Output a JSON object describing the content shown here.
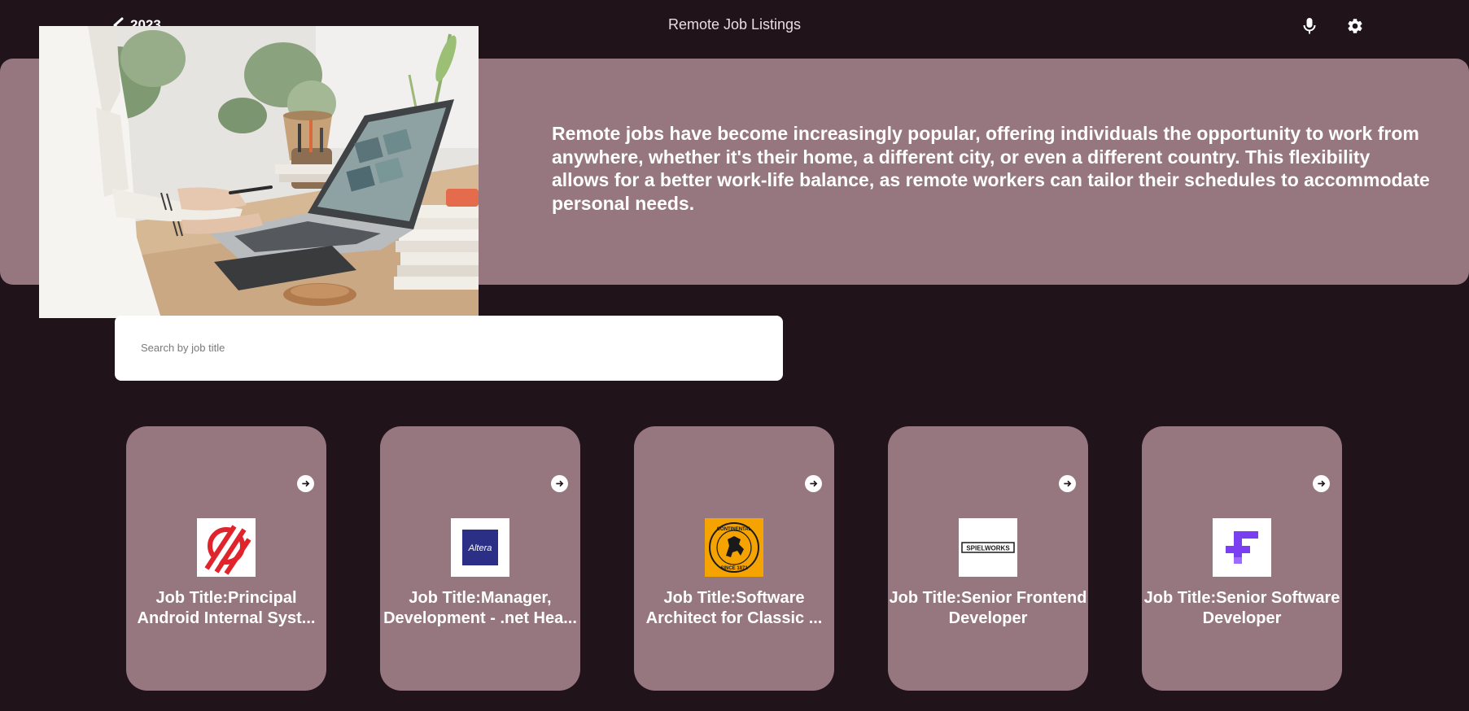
{
  "header": {
    "back_label": "2023",
    "title": "Remote Job Listings",
    "icons": [
      "back-arrow-icon",
      "microphone-icon",
      "gear-icon"
    ]
  },
  "hero": {
    "text": "Remote jobs have become increasingly popular, offering individuals the opportunity to work from anywhere, whether it's their home, a different city, or even a different country. This flexibility allows for a better work-life balance, as remote workers can tailor their schedules to accommodate personal needs.",
    "image": "person-typing-on-laptop-at-desk"
  },
  "search": {
    "placeholder": "Search by job title",
    "value": ""
  },
  "jobs": [
    {
      "title_line1": "Job Title:Principal",
      "title_line2": "Android Internal Syst...",
      "logo": "red-slashed-circle-logo"
    },
    {
      "title_line1": "Job Title:Manager,",
      "title_line2": "Development - .net Hea...",
      "logo": "altera-logo",
      "logo_text": "Altera"
    },
    {
      "title_line1": "Job Title:Software",
      "title_line2": "Architect for Classic ...",
      "logo": "continental-horse-logo",
      "logo_text_top": "CONTINENTAL",
      "logo_text_bottom": "SINCE 1871"
    },
    {
      "title_line1": "Job Title:Senior Frontend",
      "title_line2": "Developer",
      "logo": "spielworks-logo",
      "logo_text": "SPIELWORKS"
    },
    {
      "title_line1": "Job Title:Senior Software",
      "title_line2": "Developer",
      "logo": "purple-f-logo"
    }
  ],
  "colors": {
    "background": "#21131a",
    "panel": "#96767f",
    "text": "#ffffff"
  }
}
